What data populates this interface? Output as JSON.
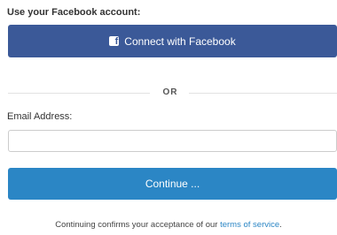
{
  "facebook": {
    "prompt": "Use your Facebook account:",
    "button_label": "Connect with Facebook",
    "icon_glyph": "f",
    "icon": "facebook-logo-icon",
    "color": "#3b5998"
  },
  "divider": {
    "text": "OR"
  },
  "email": {
    "label": "Email Address:",
    "value": "",
    "placeholder": ""
  },
  "continue": {
    "label": "Continue ...",
    "color": "#2b86c5"
  },
  "terms": {
    "prefix": "Continuing confirms your acceptance of our ",
    "link_text": "terms of service",
    "suffix": "."
  }
}
